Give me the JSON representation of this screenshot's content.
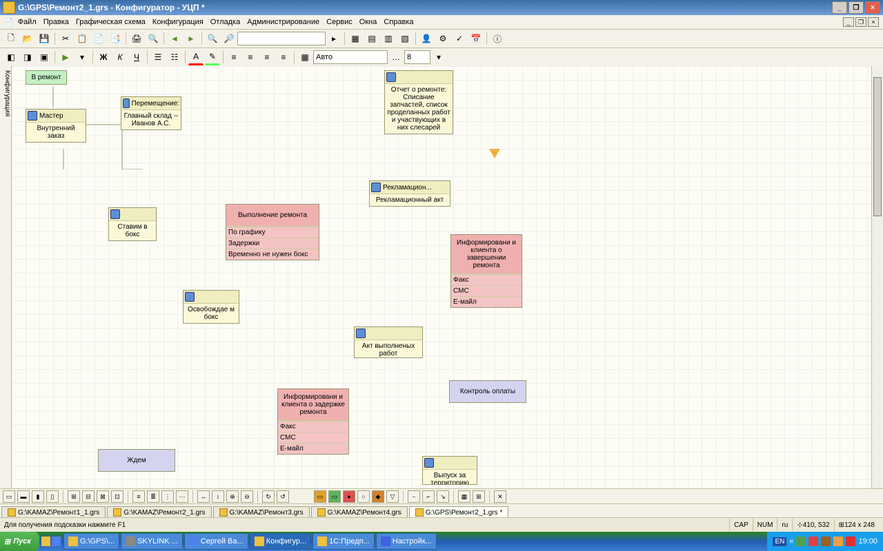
{
  "title": "G:\\GPS\\Ремонт2_1.grs - Конфигуратор - УЦП *",
  "menu": [
    "Файл",
    "Правка",
    "Графическая схема",
    "Конфигурация",
    "Отладка",
    "Администрирование",
    "Сервис",
    "Окна",
    "Справка"
  ],
  "menu_icon": "📄",
  "toolbar2": {
    "font_family": "Авто",
    "font_size": "8"
  },
  "sidebar_label": "Конфигурация",
  "nodes": {
    "start": {
      "label": "В ремонт"
    },
    "master": {
      "hdr": "Мастер",
      "body": "Внутренний заказ"
    },
    "move": {
      "hdr": "Перемещение:",
      "body": "Главный склад -- Иванов А.С."
    },
    "box": {
      "hdr": "",
      "body": "Ставим в бокс"
    },
    "repair": {
      "hdr": "Выполнение ремонта",
      "rows": [
        "По графику",
        "Задержки",
        "Временно не нужен бокс"
      ]
    },
    "free": {
      "hdr": "",
      "body": "Освобождае м бокс"
    },
    "wait": {
      "body": "Ждем"
    },
    "inform_delay": {
      "hdr": "Информировани и клиента о задержке ремонта",
      "rows": [
        "Факс",
        "СМС",
        "Е-майл"
      ]
    },
    "report": {
      "hdr": "",
      "body": "Отчет о ремонте: Списание запчастей, список проделанных работ и участвующих в них слесарей"
    },
    "reclaim": {
      "hdr": "Рекламацион...",
      "body": "Рекламационный акт"
    },
    "inform_done": {
      "hdr": "Информировани и клиента о завершении ремонта",
      "rows": [
        "Факс",
        "СМС",
        "Е-майл"
      ]
    },
    "act": {
      "hdr": "",
      "body": "Акт выполненых работ"
    },
    "pay": {
      "body": "Контроль оплаты"
    },
    "release": {
      "hdr": "",
      "body": "Выпуск за территорию"
    }
  },
  "tabs": [
    "G:\\KAMAZ\\Ремонт1_1.grs",
    "G:\\KAMAZ\\Ремонт2_1.grs",
    "G:\\KAMAZ\\Ремонт3.grs",
    "G:\\KAMAZ\\Ремонт4.grs",
    "G:\\GPS\\Ремонт2_1.grs *"
  ],
  "status": {
    "hint": "Для получения подсказки нажмите F1",
    "cap": "CAP",
    "num": "NUM",
    "lang": "ru",
    "pos": "410, 532",
    "size": "124 x 248"
  },
  "taskbar": {
    "start": "Пуск",
    "items": [
      {
        "label": "G:\\GPS\\..."
      },
      {
        "label": "SKYLINK ..."
      },
      {
        "label": "Сергей Ва..."
      },
      {
        "label": "Конфигур...",
        "active": true
      },
      {
        "label": "1С:Предп..."
      },
      {
        "label": "Настройк..."
      }
    ],
    "lang": "EN",
    "time": "19:00"
  }
}
